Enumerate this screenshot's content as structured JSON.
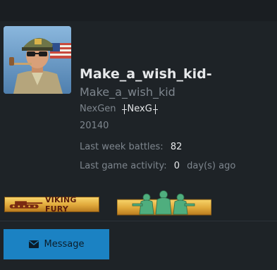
{
  "profile": {
    "display_name": "Make_a_wish_kid-",
    "username": "Make_a_wish_kid",
    "clan": {
      "name": "NexGen",
      "tag": "NexG"
    },
    "player_id": "20140"
  },
  "stats": {
    "last_week_battles_label": "Last week battles",
    "last_week_battles_value": "82",
    "last_activity_label": "Last game activity",
    "last_activity_value": "0",
    "last_activity_unit": "day(s) ago"
  },
  "medals": {
    "viking_text": "VIKING FURY"
  },
  "actions": {
    "message_label": "Message"
  },
  "icons": {
    "avatar": "general-portrait",
    "message": "envelope-icon",
    "medal_left": "tank-icon",
    "medal_right": "soldiers-icon"
  },
  "colors": {
    "background": "#1e2327",
    "button": "#1b82c3",
    "text_primary": "#e6e8ea",
    "text_muted": "#7e868e",
    "medal_gold": "#e0a83a",
    "medal_green": "#4fae7e"
  }
}
